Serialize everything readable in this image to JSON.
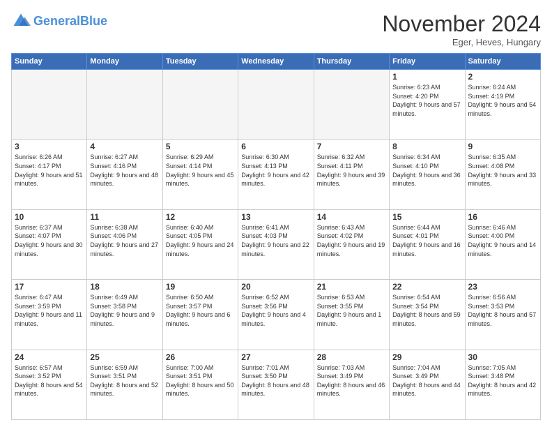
{
  "header": {
    "logo_general": "General",
    "logo_blue": "Blue",
    "month_title": "November 2024",
    "subtitle": "Eger, Heves, Hungary"
  },
  "weekdays": [
    "Sunday",
    "Monday",
    "Tuesday",
    "Wednesday",
    "Thursday",
    "Friday",
    "Saturday"
  ],
  "weeks": [
    [
      {
        "day": "",
        "empty": true
      },
      {
        "day": "",
        "empty": true
      },
      {
        "day": "",
        "empty": true
      },
      {
        "day": "",
        "empty": true
      },
      {
        "day": "",
        "empty": true
      },
      {
        "day": "1",
        "sunrise": "6:23 AM",
        "sunset": "4:20 PM",
        "daylight": "9 hours and 57 minutes."
      },
      {
        "day": "2",
        "sunrise": "6:24 AM",
        "sunset": "4:19 PM",
        "daylight": "9 hours and 54 minutes."
      }
    ],
    [
      {
        "day": "3",
        "sunrise": "6:26 AM",
        "sunset": "4:17 PM",
        "daylight": "9 hours and 51 minutes."
      },
      {
        "day": "4",
        "sunrise": "6:27 AM",
        "sunset": "4:16 PM",
        "daylight": "9 hours and 48 minutes."
      },
      {
        "day": "5",
        "sunrise": "6:29 AM",
        "sunset": "4:14 PM",
        "daylight": "9 hours and 45 minutes."
      },
      {
        "day": "6",
        "sunrise": "6:30 AM",
        "sunset": "4:13 PM",
        "daylight": "9 hours and 42 minutes."
      },
      {
        "day": "7",
        "sunrise": "6:32 AM",
        "sunset": "4:11 PM",
        "daylight": "9 hours and 39 minutes."
      },
      {
        "day": "8",
        "sunrise": "6:34 AM",
        "sunset": "4:10 PM",
        "daylight": "9 hours and 36 minutes."
      },
      {
        "day": "9",
        "sunrise": "6:35 AM",
        "sunset": "4:08 PM",
        "daylight": "9 hours and 33 minutes."
      }
    ],
    [
      {
        "day": "10",
        "sunrise": "6:37 AM",
        "sunset": "4:07 PM",
        "daylight": "9 hours and 30 minutes."
      },
      {
        "day": "11",
        "sunrise": "6:38 AM",
        "sunset": "4:06 PM",
        "daylight": "9 hours and 27 minutes."
      },
      {
        "day": "12",
        "sunrise": "6:40 AM",
        "sunset": "4:05 PM",
        "daylight": "9 hours and 24 minutes."
      },
      {
        "day": "13",
        "sunrise": "6:41 AM",
        "sunset": "4:03 PM",
        "daylight": "9 hours and 22 minutes."
      },
      {
        "day": "14",
        "sunrise": "6:43 AM",
        "sunset": "4:02 PM",
        "daylight": "9 hours and 19 minutes."
      },
      {
        "day": "15",
        "sunrise": "6:44 AM",
        "sunset": "4:01 PM",
        "daylight": "9 hours and 16 minutes."
      },
      {
        "day": "16",
        "sunrise": "6:46 AM",
        "sunset": "4:00 PM",
        "daylight": "9 hours and 14 minutes."
      }
    ],
    [
      {
        "day": "17",
        "sunrise": "6:47 AM",
        "sunset": "3:59 PM",
        "daylight": "9 hours and 11 minutes."
      },
      {
        "day": "18",
        "sunrise": "6:49 AM",
        "sunset": "3:58 PM",
        "daylight": "9 hours and 9 minutes."
      },
      {
        "day": "19",
        "sunrise": "6:50 AM",
        "sunset": "3:57 PM",
        "daylight": "9 hours and 6 minutes."
      },
      {
        "day": "20",
        "sunrise": "6:52 AM",
        "sunset": "3:56 PM",
        "daylight": "9 hours and 4 minutes."
      },
      {
        "day": "21",
        "sunrise": "6:53 AM",
        "sunset": "3:55 PM",
        "daylight": "9 hours and 1 minute."
      },
      {
        "day": "22",
        "sunrise": "6:54 AM",
        "sunset": "3:54 PM",
        "daylight": "8 hours and 59 minutes."
      },
      {
        "day": "23",
        "sunrise": "6:56 AM",
        "sunset": "3:53 PM",
        "daylight": "8 hours and 57 minutes."
      }
    ],
    [
      {
        "day": "24",
        "sunrise": "6:57 AM",
        "sunset": "3:52 PM",
        "daylight": "8 hours and 54 minutes."
      },
      {
        "day": "25",
        "sunrise": "6:59 AM",
        "sunset": "3:51 PM",
        "daylight": "8 hours and 52 minutes."
      },
      {
        "day": "26",
        "sunrise": "7:00 AM",
        "sunset": "3:51 PM",
        "daylight": "8 hours and 50 minutes."
      },
      {
        "day": "27",
        "sunrise": "7:01 AM",
        "sunset": "3:50 PM",
        "daylight": "8 hours and 48 minutes."
      },
      {
        "day": "28",
        "sunrise": "7:03 AM",
        "sunset": "3:49 PM",
        "daylight": "8 hours and 46 minutes."
      },
      {
        "day": "29",
        "sunrise": "7:04 AM",
        "sunset": "3:49 PM",
        "daylight": "8 hours and 44 minutes."
      },
      {
        "day": "30",
        "sunrise": "7:05 AM",
        "sunset": "3:48 PM",
        "daylight": "8 hours and 42 minutes."
      }
    ]
  ]
}
